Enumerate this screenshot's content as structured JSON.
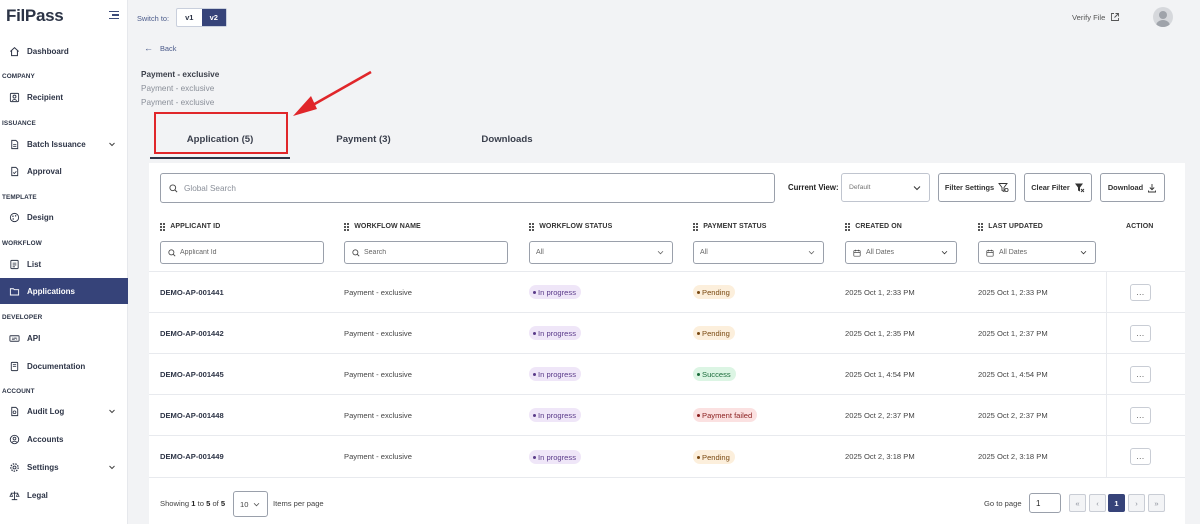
{
  "brand": {
    "logo": "FilPass"
  },
  "sidebar": {
    "sections": [
      "COMPANY",
      "ISSUANCE",
      "TEMPLATE",
      "WORKFLOW",
      "DEVELOPER",
      "ACCOUNT"
    ],
    "items": [
      {
        "label": "Dashboard",
        "icon": "home-icon"
      },
      {
        "label": "Recipient",
        "icon": "user-icon"
      },
      {
        "label": "Batch Issuance",
        "icon": "document-icon"
      },
      {
        "label": "Approval",
        "icon": "document-check-icon"
      },
      {
        "label": "Design",
        "icon": "palette-icon"
      },
      {
        "label": "List",
        "icon": "list-icon"
      },
      {
        "label": "Applications",
        "icon": "folder-icon"
      },
      {
        "label": "API",
        "icon": "api-icon"
      },
      {
        "label": "Documentation",
        "icon": "book-icon"
      },
      {
        "label": "Audit Log",
        "icon": "audit-icon"
      },
      {
        "label": "Accounts",
        "icon": "accounts-icon"
      },
      {
        "label": "Settings",
        "icon": "gear-icon"
      },
      {
        "label": "Legal",
        "icon": "scale-icon"
      }
    ]
  },
  "topbar": {
    "switch_label": "Switch to:",
    "v1": "v1",
    "v2": "v2",
    "active_version": "v2",
    "verify_file": "Verify File"
  },
  "page": {
    "back": "Back",
    "title": "Payment - exclusive",
    "subtitle1": "Payment - exclusive",
    "subtitle2": "Payment - exclusive"
  },
  "tabs": [
    {
      "label": "Application (5)",
      "active": true
    },
    {
      "label": "Payment (3)",
      "active": false
    },
    {
      "label": "Downloads",
      "active": false
    }
  ],
  "toolbar": {
    "search_placeholder": "Global Search",
    "current_view_label": "Current View:",
    "current_view_value": "Default",
    "filter_settings": "Filter Settings",
    "clear_filter": "Clear Filter",
    "download": "Download"
  },
  "table": {
    "columns": [
      "APPLICANT ID",
      "WORKFLOW NAME",
      "WORKFLOW STATUS",
      "PAYMENT STATUS",
      "CREATED ON",
      "LAST UPDATED",
      "ACTION"
    ],
    "filters": {
      "applicant_placeholder": "Applicant Id",
      "workflow_placeholder": "Search",
      "workflow_status": "All",
      "payment_status": "All",
      "created_on": "All Dates",
      "last_updated": "All Dates"
    },
    "rows": [
      {
        "id": "DEMO-AP-001441",
        "workflow": "Payment - exclusive",
        "wstatus": "In progress",
        "pstatus": "Pending",
        "pkind": "pend",
        "created": "2025 Oct 1, 2:33 PM",
        "updated": "2025 Oct 1, 2:33 PM",
        "action": "..."
      },
      {
        "id": "DEMO-AP-001442",
        "workflow": "Payment - exclusive",
        "wstatus": "In progress",
        "pstatus": "Pending",
        "pkind": "pend",
        "created": "2025 Oct 1, 2:35 PM",
        "updated": "2025 Oct 1, 2:37 PM",
        "action": "..."
      },
      {
        "id": "DEMO-AP-001445",
        "workflow": "Payment - exclusive",
        "wstatus": "In progress",
        "pstatus": "Success",
        "pkind": "succ",
        "created": "2025 Oct 1, 4:54 PM",
        "updated": "2025 Oct 1, 4:54 PM",
        "action": "..."
      },
      {
        "id": "DEMO-AP-001448",
        "workflow": "Payment - exclusive",
        "wstatus": "In progress",
        "pstatus": "Payment failed",
        "pkind": "fail",
        "created": "2025 Oct 2, 2:37 PM",
        "updated": "2025 Oct 2, 2:37 PM",
        "action": "..."
      },
      {
        "id": "DEMO-AP-001449",
        "workflow": "Payment - exclusive",
        "wstatus": "In progress",
        "pstatus": "Pending",
        "pkind": "pend",
        "created": "2025 Oct 2, 3:18 PM",
        "updated": "2025 Oct 2, 3:18 PM",
        "action": "..."
      }
    ]
  },
  "footer": {
    "showing_prefix": "Showing",
    "from": "1",
    "to_word": "to",
    "to": "5",
    "of_word": "of",
    "total": "5",
    "per_page": "10",
    "items_per_page": "Items per page",
    "go_to_page": "Go to page",
    "page_input": "1",
    "first": "«",
    "prev": "‹",
    "current_page": "1",
    "next": "›",
    "last": "»"
  },
  "colors": {
    "primary": "#364379",
    "highlight_box": "#e0262a",
    "badge_in_progress": "#efe6f8",
    "badge_pending": "#fcefdc",
    "badge_success": "#dcf5e4",
    "badge_failed": "#fbe1e1"
  }
}
